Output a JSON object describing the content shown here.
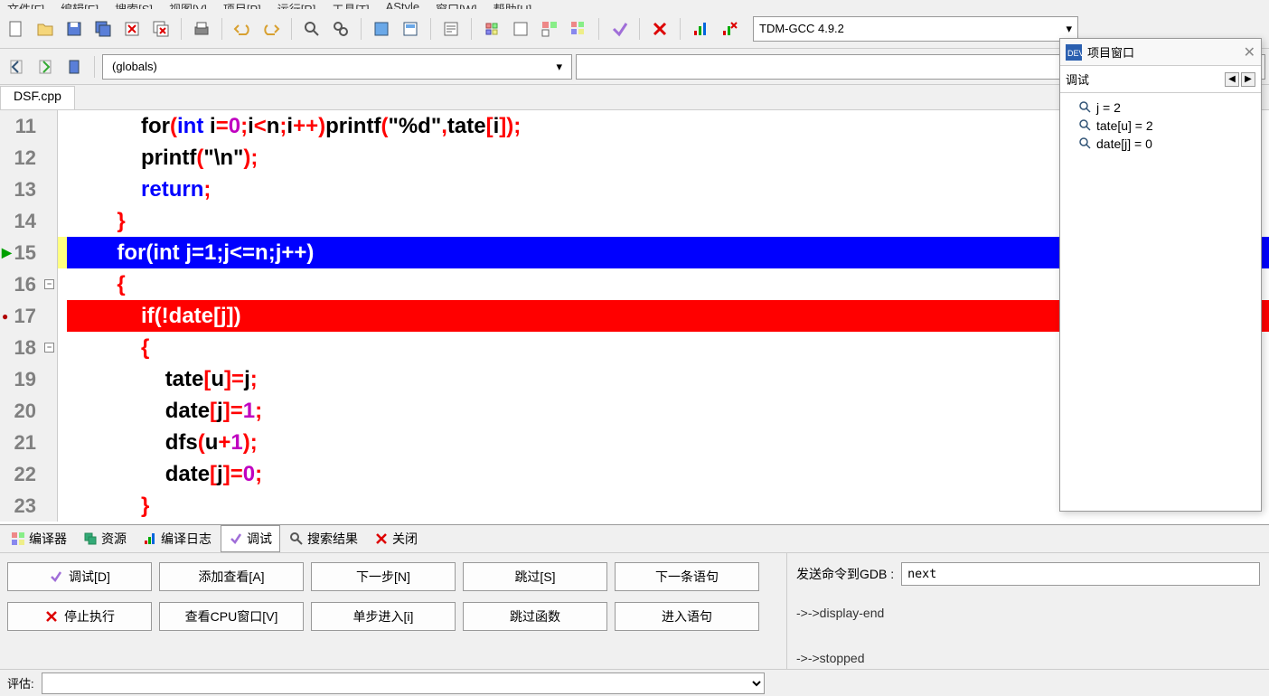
{
  "menu": {
    "items": [
      "文件[F]",
      "编辑[E]",
      "搜索[S]",
      "视图[V]",
      "项目[P]",
      "运行[R]",
      "工具[T]",
      "AStyle",
      "窗口[W]",
      "帮助[H]"
    ]
  },
  "compiler": {
    "label": "TDM-GCC 4.9.2",
    "arrow": "▾"
  },
  "globals": {
    "label": "(globals)",
    "arrow": "▾"
  },
  "file_tab": "DSF.cpp",
  "code": {
    "l11": {
      "n": "11",
      "pre": "            ",
      "t": [
        [
          "kw",
          "for"
        ],
        [
          "pn",
          "("
        ],
        [
          "blue",
          "int "
        ],
        [
          "kw",
          "i"
        ],
        [
          "pn",
          "="
        ],
        [
          "num",
          "0"
        ],
        [
          "pn",
          ";"
        ],
        [
          "kw",
          "i"
        ],
        [
          "pn",
          "<"
        ],
        [
          "kw",
          "n"
        ],
        [
          "pn",
          ";"
        ],
        [
          "kw",
          "i"
        ],
        [
          "pn",
          "++)"
        ],
        [
          "kw",
          "printf"
        ],
        [
          "pn",
          "("
        ],
        [
          "str",
          "\"%d\""
        ],
        [
          "pn",
          ","
        ],
        [
          "kw",
          "tate"
        ],
        [
          "pn",
          "["
        ],
        [
          "kw",
          "i"
        ],
        [
          "pn",
          "]);"
        ]
      ]
    },
    "l12": {
      "n": "12",
      "pre": "            ",
      "t": [
        [
          "kw",
          "printf"
        ],
        [
          "pn",
          "("
        ],
        [
          "str",
          "\"\\n\""
        ],
        [
          "pn",
          ");"
        ]
      ]
    },
    "l13": {
      "n": "13",
      "pre": "            ",
      "t": [
        [
          "blue",
          "return"
        ],
        [
          "pn",
          ";"
        ]
      ]
    },
    "l14": {
      "n": "14",
      "pre": "        ",
      "t": [
        [
          "pn",
          "}"
        ]
      ]
    },
    "l15": {
      "n": "15",
      "pre": "        ",
      "txt": "for(int j=1;j<=n;j++)"
    },
    "l16": {
      "n": "16",
      "pre": "        ",
      "t": [
        [
          "pn",
          "{"
        ]
      ]
    },
    "l17": {
      "n": "17",
      "pre": "            ",
      "txt": "if(!date[j])"
    },
    "l18": {
      "n": "18",
      "pre": "            ",
      "t": [
        [
          "pn",
          "{"
        ]
      ]
    },
    "l19": {
      "n": "19",
      "pre": "                ",
      "t": [
        [
          "kw",
          "tate"
        ],
        [
          "pn",
          "["
        ],
        [
          "kw",
          "u"
        ],
        [
          "pn",
          "]="
        ],
        [
          "kw",
          "j"
        ],
        [
          "pn",
          ";"
        ]
      ]
    },
    "l20": {
      "n": "20",
      "pre": "                ",
      "t": [
        [
          "kw",
          "date"
        ],
        [
          "pn",
          "["
        ],
        [
          "kw",
          "j"
        ],
        [
          "pn",
          "]="
        ],
        [
          "num",
          "1"
        ],
        [
          "pn",
          ";"
        ]
      ]
    },
    "l21": {
      "n": "21",
      "pre": "                ",
      "t": [
        [
          "kw",
          "dfs"
        ],
        [
          "pn",
          "("
        ],
        [
          "kw",
          "u"
        ],
        [
          "pn",
          "+"
        ],
        [
          "num",
          "1"
        ],
        [
          "pn",
          ");"
        ]
      ]
    },
    "l22": {
      "n": "22",
      "pre": "                ",
      "t": [
        [
          "kw",
          "date"
        ],
        [
          "pn",
          "["
        ],
        [
          "kw",
          "j"
        ],
        [
          "pn",
          "]="
        ],
        [
          "num",
          "0"
        ],
        [
          "pn",
          ";"
        ]
      ]
    },
    "l23": {
      "n": "23",
      "pre": "            ",
      "t": [
        [
          "pn",
          "}"
        ]
      ]
    }
  },
  "bottom_tabs": {
    "compiler": "编译器",
    "resources": "资源",
    "log": "编译日志",
    "debug": "调试",
    "search": "搜索结果",
    "close": "关闭"
  },
  "buttons": {
    "debug": "调试[D]",
    "addwatch": "添加查看[A]",
    "next": "下一步[N]",
    "skip": "跳过[S]",
    "nextstmt": "下一条语句",
    "stop": "停止执行",
    "cpuwin": "查看CPU窗口[V]",
    "stepinto": "单步进入[i]",
    "stepout": "跳过函数",
    "intostmt": "进入语句"
  },
  "gdb": {
    "label": "发送命令到GDB :",
    "value": "next",
    "log1": "->->display-end",
    "log2": "->->stopped"
  },
  "eval": {
    "label": "评估:"
  },
  "watch": {
    "title": "项目窗口",
    "sub": "调试",
    "items": [
      "j = 2",
      "tate[u] = 2",
      "date[j] = 0"
    ]
  }
}
